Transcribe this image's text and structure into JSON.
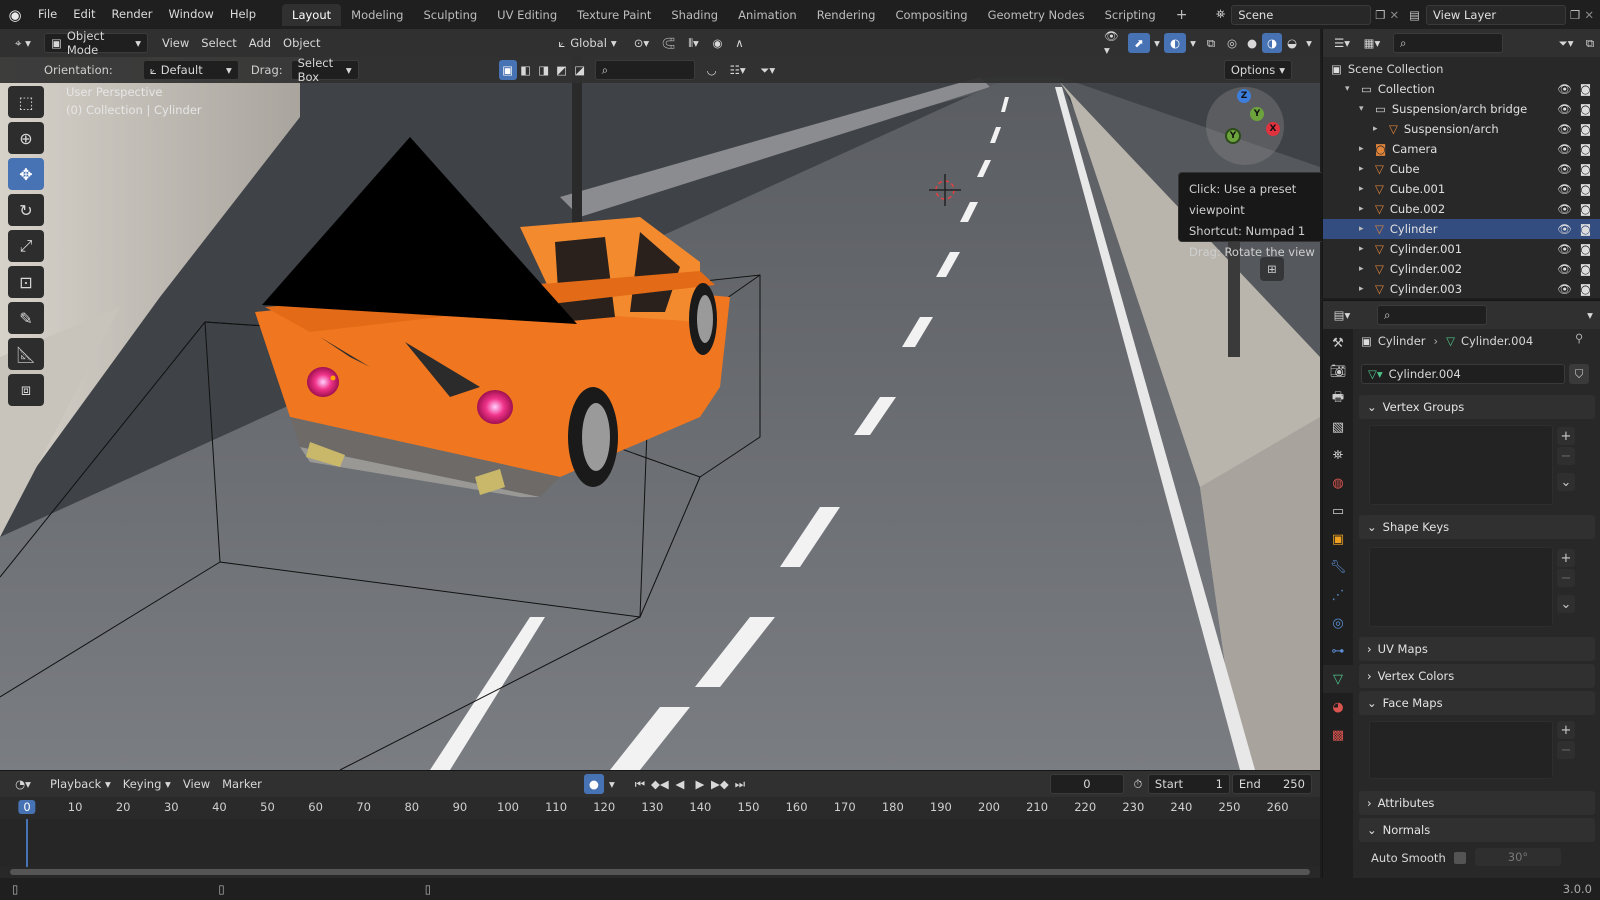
{
  "app": {
    "menu": [
      "File",
      "Edit",
      "Render",
      "Window",
      "Help"
    ],
    "workspaces": [
      "Layout",
      "Modeling",
      "Sculpting",
      "UV Editing",
      "Texture Paint",
      "Shading",
      "Animation",
      "Rendering",
      "Compositing",
      "Geometry Nodes",
      "Scripting"
    ],
    "active_workspace": "Layout",
    "add_tab": "+",
    "scene": "Scene",
    "view_layer": "View Layer",
    "version": "3.0.0"
  },
  "viewport_header": {
    "mode": "Object Mode",
    "menus": [
      "View",
      "Select",
      "Add",
      "Object"
    ],
    "transform_orientation": "Global"
  },
  "tool_header": {
    "orientation_label": "Orientation:",
    "orientation_value": "Default",
    "drag_label": "Drag:",
    "drag_value": "Select Box",
    "options": "Options"
  },
  "viewport": {
    "perspective_label": "User Perspective",
    "context_label": "(0) Collection | Cylinder",
    "gizmo_axes": [
      "Z",
      "Y",
      "X",
      "Y"
    ]
  },
  "tooltip": {
    "line1": "Click: Use a preset viewpoint",
    "line2": "Shortcut: Numpad 1",
    "line3": "Drag: Rotate the view"
  },
  "timeline": {
    "menus": [
      "Playback",
      "Keying",
      "View",
      "Marker"
    ],
    "current_frame": "0",
    "start_label": "Start",
    "start": "1",
    "end_label": "End",
    "end": "250",
    "ruler_ticks": [
      "0",
      "10",
      "20",
      "30",
      "40",
      "50",
      "60",
      "70",
      "80",
      "90",
      "100",
      "110",
      "120",
      "130",
      "140",
      "150",
      "160",
      "170",
      "180",
      "190",
      "200",
      "210",
      "220",
      "230",
      "240",
      "250",
      "260"
    ]
  },
  "outliner": {
    "root": "Scene Collection",
    "items": [
      {
        "name": "Collection",
        "indent": 1
      },
      {
        "name": "Suspension/arch bridge",
        "indent": 2
      },
      {
        "name": "Suspension/arch",
        "indent": 3
      },
      {
        "name": "Camera",
        "indent": 2
      },
      {
        "name": "Cube",
        "indent": 2
      },
      {
        "name": "Cube.001",
        "indent": 2
      },
      {
        "name": "Cube.002",
        "indent": 2
      },
      {
        "name": "Cylinder",
        "indent": 2,
        "selected": true
      },
      {
        "name": "Cylinder.001",
        "indent": 2
      },
      {
        "name": "Cylinder.002",
        "indent": 2
      },
      {
        "name": "Cylinder.003",
        "indent": 2
      }
    ]
  },
  "properties": {
    "breadcrumb_object": "Cylinder",
    "breadcrumb_data": "Cylinder.004",
    "datablock": "Cylinder.004",
    "panels": {
      "vertex_groups": "Vertex Groups",
      "shape_keys": "Shape Keys",
      "uv_maps": "UV Maps",
      "vertex_colors": "Vertex Colors",
      "face_maps": "Face Maps",
      "attributes": "Attributes",
      "normals": "Normals"
    },
    "auto_smooth_label": "Auto Smooth",
    "auto_smooth_angle": "30°"
  },
  "colors": {
    "accent": "#4772b3",
    "car_orange": "#f0771f",
    "road": "#6b6e73",
    "axis_x": "#e0323f",
    "axis_y": "#6ca33c",
    "axis_z": "#3d7ddb"
  }
}
